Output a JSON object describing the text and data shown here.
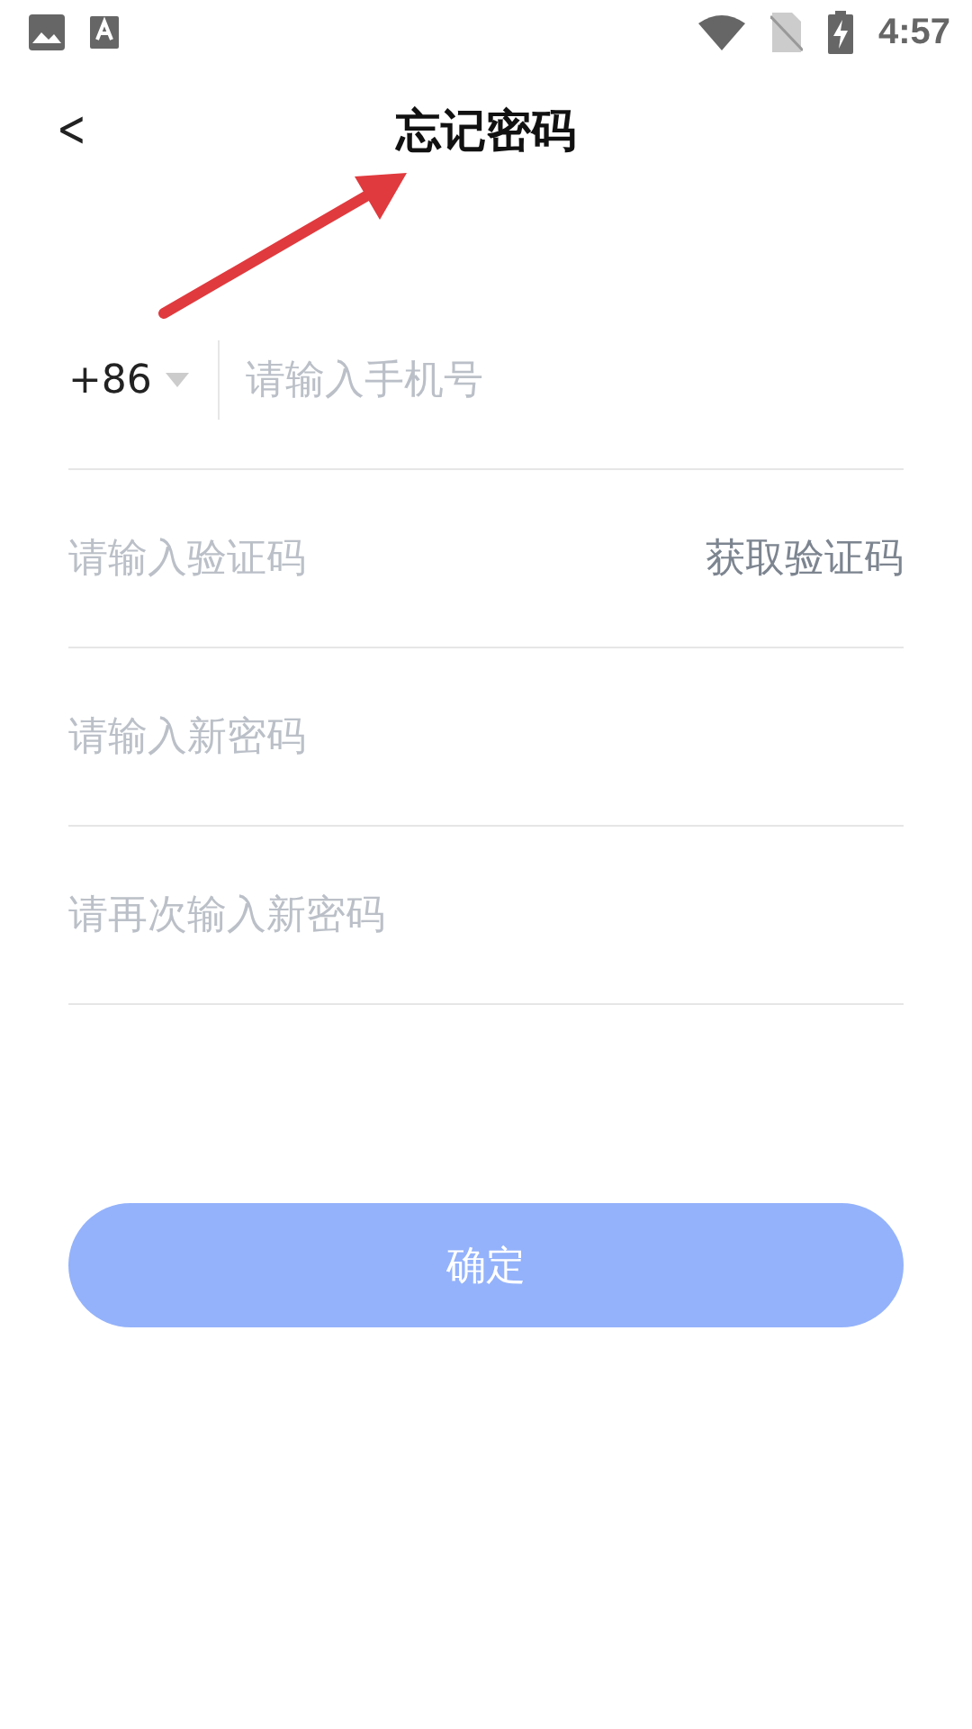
{
  "status_bar": {
    "time": "4:57"
  },
  "header": {
    "back": "<",
    "title": "忘记密码"
  },
  "fields": [
    {
      "kind": "phone",
      "country_code": "+86",
      "placeholder": "请输入手机号"
    },
    {
      "kind": "code",
      "placeholder": "请输入验证码",
      "action": "获取验证码"
    },
    {
      "kind": "plain",
      "placeholder": "请输入新密码"
    },
    {
      "kind": "plain",
      "placeholder": "请再次输入新密码"
    }
  ],
  "submit": {
    "label": "确定",
    "disabled": true
  },
  "annotation": {
    "kind": "arrow"
  }
}
